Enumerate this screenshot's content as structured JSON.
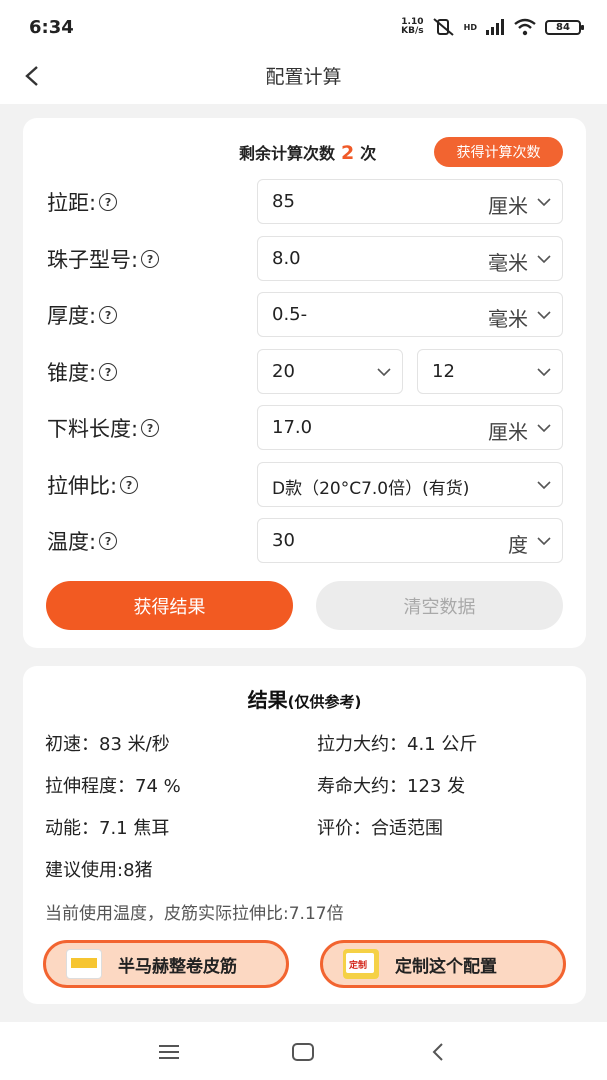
{
  "status_bar": {
    "time": "6:34",
    "net_speed_value": "1.10",
    "net_speed_unit": "KB/s",
    "network": "HD",
    "battery": "84"
  },
  "header": {
    "title": "配置计算",
    "back_icon": "chevron-left-icon"
  },
  "config": {
    "remaining_label": "剩余计算次数",
    "remaining_count": "2",
    "remaining_unit": "次",
    "get_count_button": "获得计算次数",
    "fields": {
      "draw_distance": {
        "label": "拉距:",
        "value": "85",
        "unit": "厘米"
      },
      "bead_model": {
        "label": "珠子型号:",
        "value": "8.0",
        "unit": "毫米"
      },
      "thickness": {
        "label": "厚度:",
        "value": "0.5-",
        "unit": "毫米"
      },
      "taper": {
        "label": "锥度:",
        "value_a": "20",
        "value_b": "12"
      },
      "cut_length": {
        "label": "下料长度:",
        "value": "17.0",
        "unit": "厘米"
      },
      "stretch_ratio": {
        "label": "拉伸比:",
        "value": "D款（20°C7.0倍）(有货)"
      },
      "temperature": {
        "label": "温度:",
        "value": "30",
        "unit": "度"
      }
    },
    "help_icon": "?",
    "submit_button": "获得结果",
    "clear_button": "清空数据"
  },
  "result": {
    "title": "结果",
    "subtitle": "(仅供参考)",
    "initial_speed": {
      "label": "初速：",
      "value": "83 米/秒"
    },
    "pull_force": {
      "label": "拉力大约：",
      "value": "4.1 公斤"
    },
    "stretch_degree": {
      "label": "拉伸程度：",
      "value": "74 %"
    },
    "lifespan": {
      "label": "寿命大约：",
      "value": "123 发"
    },
    "kinetic_energy": {
      "label": "动能：",
      "value": "7.1 焦耳"
    },
    "rating": {
      "label": "评价：",
      "value": "合适范围"
    },
    "suggestion": "建议使用:8猪",
    "note": "当前使用温度，皮筋实际拉伸比:7.17倍",
    "buy_button": "半马赫整卷皮筋",
    "custom_button": "定制这个配置",
    "custom_thumb_text": "定制"
  },
  "colors": {
    "accent": "#f25a22",
    "accent_light": "#fcd8c2",
    "count_red": "#f05a28"
  }
}
